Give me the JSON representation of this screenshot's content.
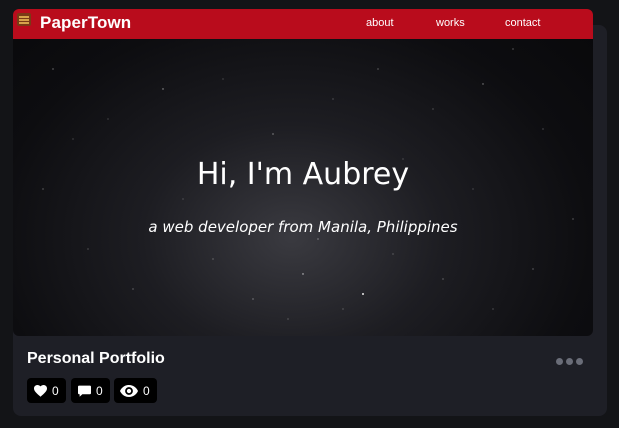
{
  "site": {
    "brand": "PaperTown",
    "nav": [
      "about",
      "works",
      "contact"
    ],
    "hero_title": "Hi, I'm Aubrey",
    "hero_subtitle": "a web developer from Manila, Philippines"
  },
  "card": {
    "title": "Personal Portfolio",
    "stats": {
      "likes": "0",
      "comments": "0",
      "views": "0"
    }
  },
  "colors": {
    "navbar": "#b90c1c",
    "card_bg": "#1e1f26",
    "page_bg": "#131417"
  }
}
